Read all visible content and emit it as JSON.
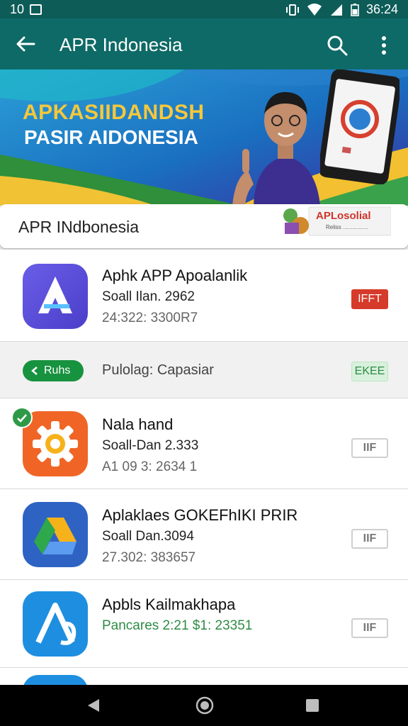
{
  "status_bar": {
    "time_left": "10",
    "time_right": "36:24"
  },
  "app_bar": {
    "title": "APR Indonesia"
  },
  "banner": {
    "headline": "APKASIIDANDSH",
    "subheadline": "PASIR AIDONESIA"
  },
  "search_card": {
    "label": "APR INdbonesia",
    "promo_text": "APLosolial",
    "promo_subtext": "Reliss ................"
  },
  "apps": [
    {
      "name": "Aphk APP Apoalanlik",
      "line2": "Soall Ilan. 2962",
      "line3": "24:322: 3300R7",
      "button": "IFFT",
      "button_style": "red",
      "icon_color": "#5b4fd6"
    },
    {
      "name": "Nala hand",
      "line2": "Soall-Dan 2.333",
      "line3": "A1 09 3: 2634 1",
      "button": "IIF",
      "button_style": "outline",
      "icon_color": "#f06526"
    },
    {
      "name": "Aplaklaes GOKEFhIKI PRIR",
      "line2": "Soall Dan.3094",
      "line3": "27.302: 383657",
      "button": "IIF",
      "button_style": "outline",
      "icon_color": "#2e63c4"
    },
    {
      "name": "Apbls Kailmakhapa",
      "line2": "Pancares 2:21 $1: 23351",
      "line3": "",
      "button": "IIF",
      "button_style": "outline",
      "icon_color": "#1e8fe0"
    }
  ],
  "filter_row": {
    "chip": "Ruhs",
    "label": "Pulolag: Capasiar",
    "button": "EKEE"
  },
  "colors": {
    "app_bar": "#0e6a66",
    "status_bar": "#0d5c58",
    "chip_green": "#17923f",
    "install_red": "#d63a2a"
  }
}
